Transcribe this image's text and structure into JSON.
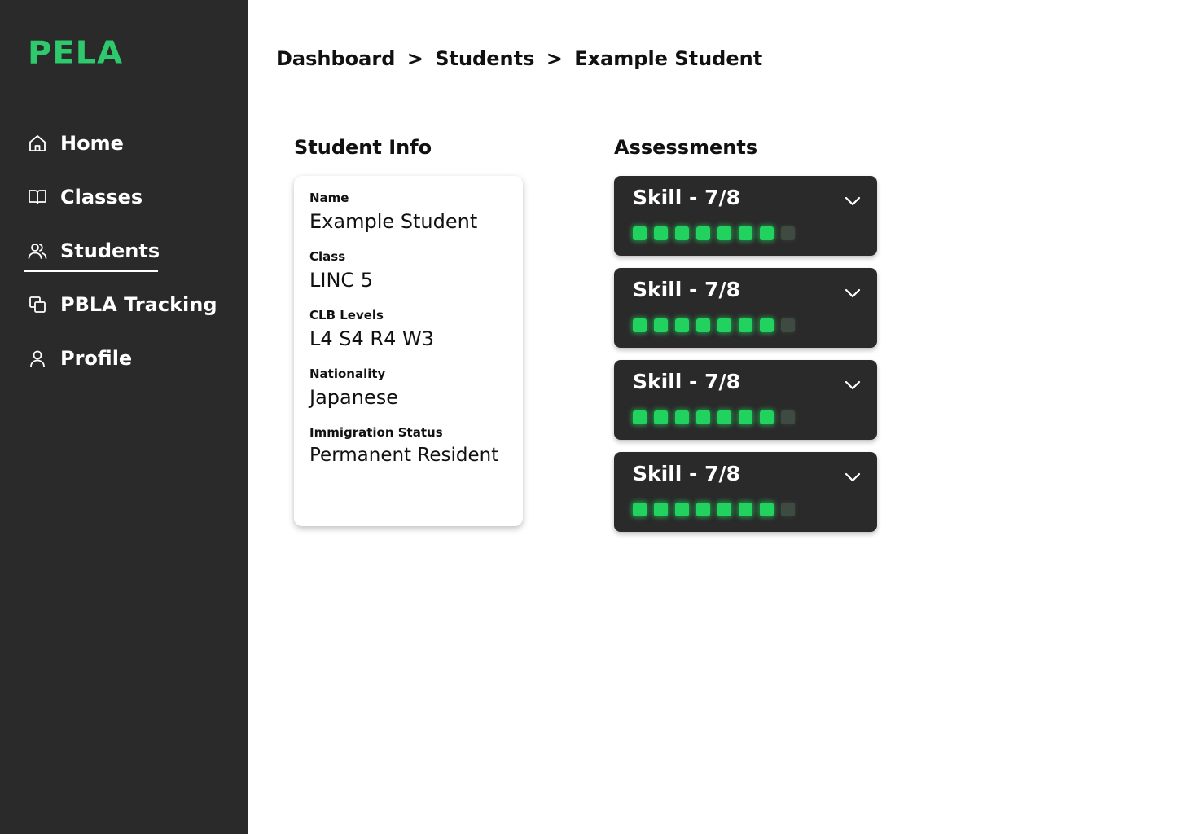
{
  "app": {
    "logo": "PELA",
    "brand_color": "#2ec96c",
    "sidebar_bg": "#2a2a2a"
  },
  "sidebar": {
    "items": [
      {
        "label": "Home",
        "icon": "home-icon",
        "active": false
      },
      {
        "label": "Classes",
        "icon": "book-icon",
        "active": false
      },
      {
        "label": "Students",
        "icon": "users-icon",
        "active": true
      },
      {
        "label": "PBLA Tracking",
        "icon": "copy-icon",
        "active": false
      },
      {
        "label": "Profile",
        "icon": "user-icon",
        "active": false
      }
    ]
  },
  "breadcrumb": {
    "level1": "Dashboard",
    "sep1": ">",
    "level2": "Students",
    "sep2": ">",
    "level3": "Example Student"
  },
  "student_info": {
    "title": "Student Info",
    "fields": [
      {
        "label": "Name",
        "value": "Example Student"
      },
      {
        "label": "Class",
        "value": "LINC 5"
      },
      {
        "label": "CLB Levels",
        "value": "L4 S4 R4 W3"
      },
      {
        "label": "Nationality",
        "value": "Japanese"
      },
      {
        "label": "Immigration Status",
        "value": "Permanent Resident"
      }
    ]
  },
  "assessments": {
    "title": "Assessments",
    "items": [
      {
        "label": "Skill - 7/8",
        "completed": 7,
        "total": 8,
        "expand_icon": "chevron-down-icon"
      },
      {
        "label": "Skill - 7/8",
        "completed": 7,
        "total": 8,
        "expand_icon": "chevron-down-icon"
      },
      {
        "label": "Skill - 7/8",
        "completed": 7,
        "total": 8,
        "expand_icon": "chevron-down-icon"
      },
      {
        "label": "Skill - 7/8",
        "completed": 7,
        "total": 8,
        "expand_icon": "chevron-down-icon"
      }
    ],
    "on_color": "#22d25f",
    "off_color": "#3f4a42"
  }
}
